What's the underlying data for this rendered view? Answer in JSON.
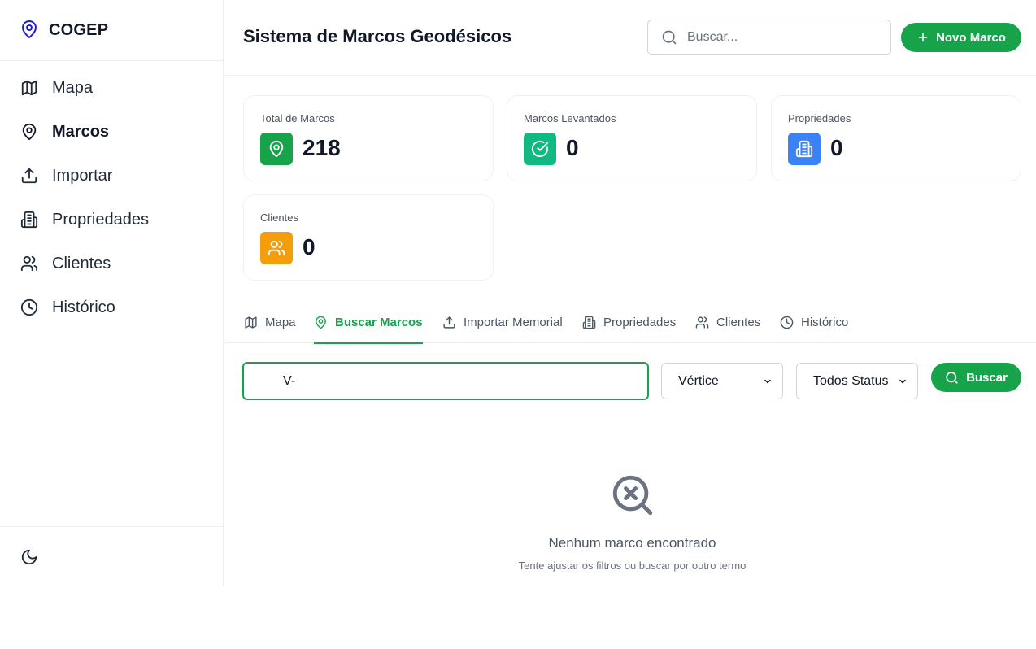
{
  "brand": {
    "name": "COGEP",
    "icon": "map-pin-icon",
    "color": "#1d1fd6"
  },
  "sidebar": {
    "items": [
      {
        "label": "Mapa",
        "icon": "map-icon",
        "active": false
      },
      {
        "label": "Marcos",
        "icon": "map-pin-icon",
        "active": true
      },
      {
        "label": "Importar",
        "icon": "upload-icon",
        "active": false
      },
      {
        "label": "Propriedades",
        "icon": "building-icon",
        "active": false
      },
      {
        "label": "Clientes",
        "icon": "users-icon",
        "active": false
      },
      {
        "label": "Histórico",
        "icon": "clock-icon",
        "active": false
      }
    ],
    "footer_icon": "moon-icon"
  },
  "header": {
    "title": "Sistema de Marcos Geodésicos",
    "search_placeholder": "Buscar...",
    "new_button": "Novo Marco"
  },
  "stats": [
    {
      "label": "Total de Marcos",
      "value": "218",
      "icon": "map-pin-icon",
      "color": "#16a34a"
    },
    {
      "label": "Marcos Levantados",
      "value": "0",
      "icon": "check-circle-icon",
      "color": "#10b981"
    },
    {
      "label": "Propriedades",
      "value": "0",
      "icon": "building-icon",
      "color": "#3b82f6"
    },
    {
      "label": "Clientes",
      "value": "0",
      "icon": "users-icon",
      "color": "#f59e0b"
    }
  ],
  "tabs": [
    {
      "label": "Mapa",
      "icon": "map-icon",
      "active": false
    },
    {
      "label": "Buscar Marcos",
      "icon": "map-pin-icon",
      "active": true
    },
    {
      "label": "Importar Memorial",
      "icon": "upload-icon",
      "active": false
    },
    {
      "label": "Propriedades",
      "icon": "building-icon",
      "active": false
    },
    {
      "label": "Clientes",
      "icon": "users-icon",
      "active": false
    },
    {
      "label": "Histórico",
      "icon": "clock-icon",
      "active": false
    }
  ],
  "filters": {
    "query": "V-",
    "type_select": "Vértice",
    "status_select": "Todos Status",
    "search_button": "Buscar"
  },
  "empty": {
    "icon": "search-x-icon",
    "title": "Nenhum marco encontrado",
    "subtitle": "Tente ajustar os filtros ou buscar por outro termo"
  },
  "colors": {
    "accent": "#16a34a",
    "text": "#111827",
    "muted": "#4b5563"
  }
}
